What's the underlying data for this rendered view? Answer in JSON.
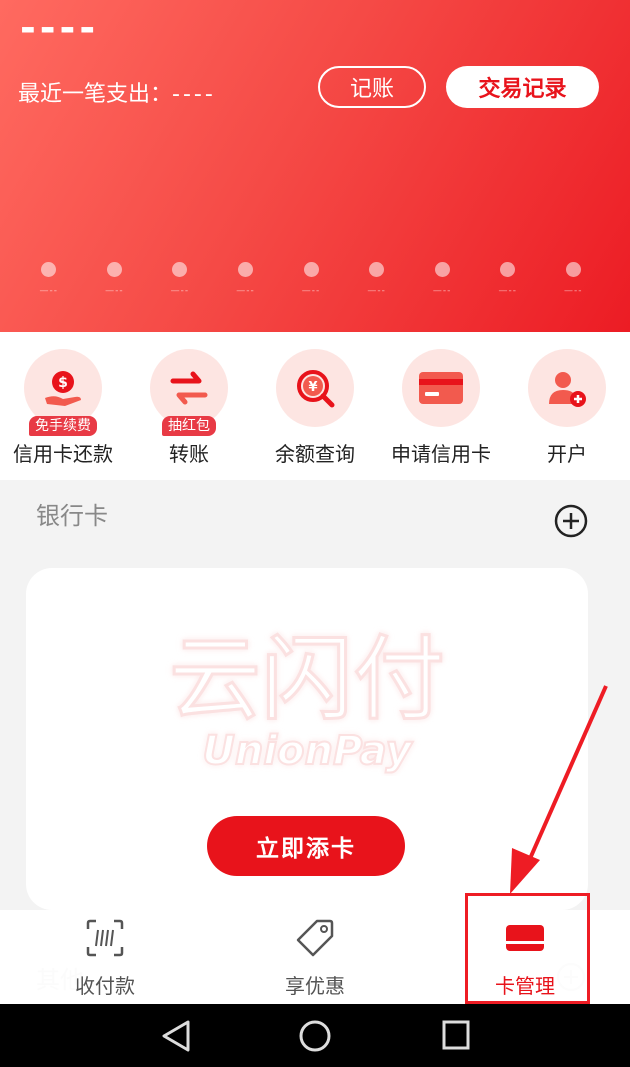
{
  "header": {
    "amount": "----",
    "recent_label": "最近一笔支出：",
    "recent_value": "----",
    "btn_bookkeeping": "记账",
    "btn_transactions": "交易记录",
    "dot_labels": [
      "—--",
      "—--",
      "—--",
      "—--",
      "—--",
      "—--",
      "—--",
      "—--",
      "—--"
    ]
  },
  "actions": [
    {
      "label": "信用卡还款",
      "tag": "免手续费",
      "icon": "dollar-hand-icon"
    },
    {
      "label": "转账",
      "tag": "抽红包",
      "icon": "transfer-arrows-icon"
    },
    {
      "label": "余额查询",
      "tag": "",
      "icon": "yen-search-icon"
    },
    {
      "label": "申请信用卡",
      "tag": "",
      "icon": "credit-card-icon"
    },
    {
      "label": "开户",
      "tag": "",
      "icon": "add-user-icon"
    }
  ],
  "bank": {
    "title": "银行卡",
    "logo_cn": "云闪付",
    "logo_en": "UnionPay",
    "add_card": "立即添卡"
  },
  "other_section": {
    "title": "其他"
  },
  "tabs": [
    {
      "label": "收付款",
      "icon": "scan-code-icon",
      "active": false
    },
    {
      "label": "享优惠",
      "icon": "tag-icon",
      "active": false
    },
    {
      "label": "卡管理",
      "icon": "card-icon",
      "active": true
    }
  ],
  "colors": {
    "brand_red": "#e8131b",
    "accent_pink": "#fde5e2",
    "highlight": "#ee1c24"
  }
}
